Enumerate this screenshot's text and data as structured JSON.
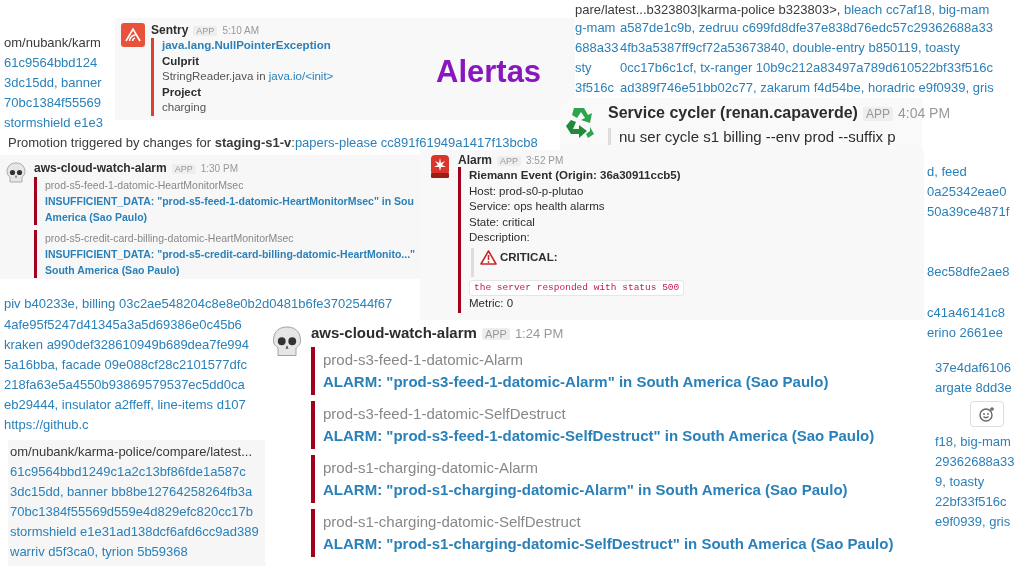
{
  "title": "Alertas",
  "log_fragments": [
    {
      "lines": [
        [
          {
            "text": "om/nubank/karm",
            "link": false
          }
        ],
        [
          {
            "text": "61c9564bbd124",
            "link": true
          }
        ],
        [
          {
            "text": "3dc15dd, banner",
            "link": true
          }
        ],
        [
          {
            "text": "70bc1384f55569",
            "link": true
          }
        ],
        [
          {
            "text": "stormshield e1e3",
            "link": true
          }
        ]
      ]
    },
    {
      "lines": [
        [
          {
            "text": "pare/latest...b323803|karma-police b323803>, ",
            "link": false
          },
          {
            "text": "bleach cc7af18, big-mam",
            "link": true
          }
        ]
      ]
    },
    {
      "lines": [
        [
          {
            "text": "g-mam",
            "link": true
          }
        ],
        [
          {
            "text": "688a33",
            "link": true
          }
        ],
        [
          {
            "text": "sty",
            "link": true
          }
        ],
        [
          {
            "text": "3f516c",
            "link": true
          }
        ]
      ]
    },
    {
      "lines": [
        [
          {
            "text": "a587de1c9b, zedruu c699fd8dfe37e838d76edc57c29362688a33",
            "link": true
          }
        ],
        [
          {
            "text": "4fb3a5387ff9cf72a53673840, double-entry b850119, toasty",
            "link": true
          }
        ],
        [
          {
            "text": "0cc17b6c1cf, tx-ranger 10b9c212a83497a789d610522bf33f516c",
            "link": true
          }
        ],
        [
          {
            "text": "ad389f746e51bb02c77, zakarum f4d54be, horadric e9f0939, gris",
            "link": true
          }
        ]
      ]
    },
    {
      "lines": [
        [
          {
            "text": "Promotion triggered by changes for **staging-s1-v**:",
            "link": false
          },
          {
            "text": "papers-please cc891f61949a1417f13bcb8",
            "link": true
          }
        ]
      ]
    },
    {
      "lines": [
        [
          {
            "text": "d, feed",
            "link": true
          }
        ],
        [
          {
            "text": "0a25342eae0",
            "link": true
          }
        ],
        [
          {
            "text": "50a39ce4871f",
            "link": true
          }
        ]
      ]
    },
    {
      "lines": [
        [
          {
            "text": "8ec58dfe2ae8",
            "link": true
          }
        ]
      ]
    },
    {
      "lines": [
        [
          {
            "text": "c41a46141c8",
            "link": true
          }
        ],
        [
          {
            "text": "erino 2661ee",
            "link": true
          }
        ]
      ]
    },
    {
      "lines": [
        [
          {
            "text": "37e4daf6106",
            "link": true
          }
        ],
        [
          {
            "text": "argate 8dd3e",
            "link": true
          }
        ]
      ]
    },
    {
      "lines": [
        [
          {
            "text": "f18, big-mam",
            "link": true
          }
        ],
        [
          {
            "text": "29362688a33",
            "link": true
          }
        ],
        [
          {
            "text": "9, toasty",
            "link": true
          }
        ],
        [
          {
            "text": "22bf33f516c",
            "link": true
          }
        ],
        [
          {
            "text": "e9f0939, gris",
            "link": true
          }
        ]
      ]
    },
    {
      "lines": [
        [
          {
            "text": "piv b40233e, billing 03c2ae548204c8e8e0b2d0481b6fe3702544f67",
            "link": true
          }
        ]
      ]
    },
    {
      "lines": [
        [
          {
            "text": "4afe95f5247d41345a3a5d69386e0c45b6",
            "link": true
          }
        ],
        [
          {
            "text": "kraken a990def328610949b689dea7fe994",
            "link": true
          }
        ],
        [
          {
            "text": "5a16bba, facade 09e088cf28c2101577dfc",
            "link": true
          }
        ],
        [
          {
            "text": "218fa63e5a4550b93869579537ec5dd0ca",
            "link": true
          }
        ],
        [
          {
            "text": "eb29444, insulator a2ffeff, line-items d107",
            "link": true
          }
        ],
        [
          {
            "text": "https://github.c",
            "link": true
          }
        ]
      ]
    },
    {
      "lines": [
        [
          {
            "text": "om/nubank/karma-police/compare/latest...",
            "link": false
          }
        ],
        [
          {
            "text": "61c9564bbd1249c1a2c13bf86fde1a587c",
            "link": true
          }
        ],
        [
          {
            "text": "3dc15dd, banner bb8be12764258264fb3a",
            "link": true
          }
        ],
        [
          {
            "text": "70bc1384f55569d559e4d829efc820cc17b",
            "link": true
          }
        ],
        [
          {
            "text": "stormshield e1e31ad138dcf6afd6cc9ad389",
            "link": true
          }
        ],
        [
          {
            "text": "warriv d5f3ca0, tyrion 5b59368",
            "link": true
          }
        ]
      ]
    }
  ],
  "sentry_message": {
    "sender": "Sentry",
    "badge": "APP",
    "time": "5:10 AM",
    "exception": "java.lang.NullPointerException",
    "fields": [
      {
        "label": "Culprit",
        "value": [
          {
            "text": "StringReader.java in ",
            "link": false
          },
          {
            "text": "java.io/<init>",
            "link": true
          }
        ]
      },
      {
        "label": "Project",
        "value": [
          {
            "text": "charging",
            "link": false
          }
        ]
      }
    ]
  },
  "service_cycler_message": {
    "sender": "Service cycler (renan.capaverde)",
    "badge": "APP",
    "time": "4:04 PM",
    "quote": "nu ser cycle s1 billing --env prod --suffix p"
  },
  "cloudwatch_message_small": {
    "sender": "aws-cloud-watch-alarm",
    "badge": "APP",
    "time": "1:30 PM",
    "attachments": [
      {
        "title": "prod-s5-feed-1-datomic-HeartMonitorMsec",
        "text": "INSUFFICIENT_DATA: \"prod-s5-feed-1-datomic-HeartMonitorMsec\" in Sou",
        "text_2": "America (Sao Paulo)"
      },
      {
        "title": "prod-s5-credit-card-billing-datomic-HeartMonitorMsec",
        "text": "INSUFFICIENT_DATA: \"prod-s5-credit-card-billing-datomic-HeartMonito...\"",
        "text_2": "South America (Sao Paulo)"
      }
    ]
  },
  "alarm_message": {
    "sender": "Alarm",
    "badge": "APP",
    "time": "3:52 PM",
    "heading": "Riemann Event (Origin: 36a30911ccb5)",
    "fields": [
      "Host: prod-s0-p-plutao",
      "Service: ops health alarms",
      "State: critical",
      "Description:"
    ],
    "severity": "CRITICAL:",
    "code": "the server responded with status 500",
    "metric": "Metric: 0"
  },
  "cloudwatch_message_large": {
    "sender": "aws-cloud-watch-alarm",
    "badge": "APP",
    "time": "1:24 PM",
    "attachments": [
      {
        "title": "prod-s3-feed-1-datomic-Alarm",
        "text": "ALARM: \"prod-s3-feed-1-datomic-Alarm\" in South America (Sao Paulo)"
      },
      {
        "title": "prod-s3-feed-1-datomic-SelfDestruct",
        "text": "ALARM: \"prod-s3-feed-1-datomic-SelfDestruct\" in South America (Sao Paulo)"
      },
      {
        "title": "prod-s1-charging-datomic-Alarm",
        "text": "ALARM: \"prod-s1-charging-datomic-Alarm\" in South America (Sao Paulo)"
      },
      {
        "title": "prod-s1-charging-datomic-SelfDestruct",
        "text": "ALARM: \"prod-s1-charging-datomic-SelfDestruct\" in South America (Sao Paulo)"
      }
    ]
  }
}
